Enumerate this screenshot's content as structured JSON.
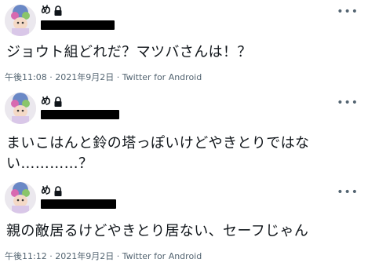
{
  "tweets": [
    {
      "name": "め",
      "text": "ジョウト組どれだ？マツバさんは！？",
      "time": "午後11:08",
      "date": "2021年9月2日",
      "source": "Twitter for Android",
      "separator": "·"
    },
    {
      "name": "め",
      "text": "まいこはんと鈴の塔っぽいけどやきとりではない…………？"
    },
    {
      "name": "め",
      "text": "親の敵居るけどやきとり居ない、セーフじゃん",
      "time": "午後11:12",
      "date": "2021年9月2日",
      "source": "Twitter for Android",
      "separator": "·"
    }
  ],
  "icons": {
    "lock": "lock-icon",
    "more": "more-options-icon"
  },
  "colors": {
    "text": "#0f1419",
    "meta": "#536471",
    "background": "#ffffff"
  }
}
